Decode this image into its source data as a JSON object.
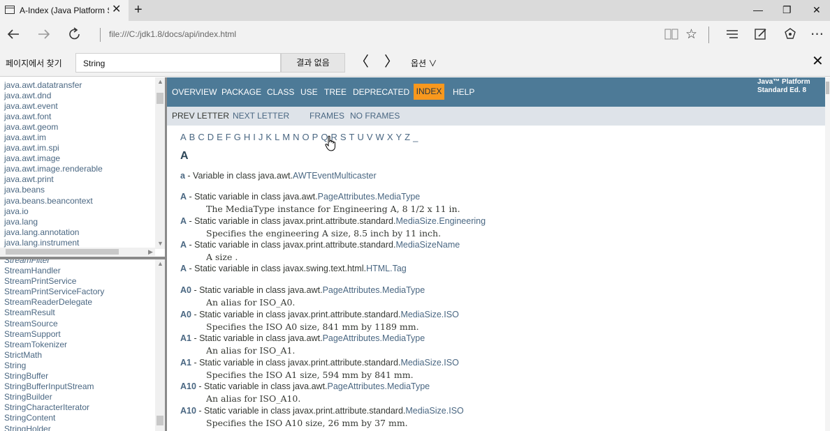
{
  "browser": {
    "tab_title": "A-Index (Java Platform S",
    "tab_close": "✕",
    "new_tab": "+",
    "window_minimize": "—",
    "window_restore": "❐",
    "window_close": "✕",
    "url": "file:///C:/jdk1.8/docs/api/index.html"
  },
  "find_bar": {
    "label": "페이지에서 찾기",
    "value": "String",
    "result": "결과 없음",
    "options": "옵션 ∨",
    "close": "✕",
    "prev": "〈",
    "next": "〉"
  },
  "packages": [
    "java.awt.datatransfer",
    "java.awt.dnd",
    "java.awt.event",
    "java.awt.font",
    "java.awt.geom",
    "java.awt.im",
    "java.awt.im.spi",
    "java.awt.image",
    "java.awt.image.renderable",
    "java.awt.print",
    "java.beans",
    "java.beans.beancontext",
    "java.io",
    "java.lang",
    "java.lang.annotation",
    "java.lang.instrument"
  ],
  "classes": [
    {
      "name": "StreamFilter",
      "italic": true
    },
    {
      "name": "StreamHandler",
      "italic": false
    },
    {
      "name": "StreamPrintService",
      "italic": false
    },
    {
      "name": "StreamPrintServiceFactory",
      "italic": false
    },
    {
      "name": "StreamReaderDelegate",
      "italic": false
    },
    {
      "name": "StreamResult",
      "italic": false
    },
    {
      "name": "StreamSource",
      "italic": false
    },
    {
      "name": "StreamSupport",
      "italic": false
    },
    {
      "name": "StreamTokenizer",
      "italic": false
    },
    {
      "name": "StrictMath",
      "italic": false
    },
    {
      "name": "String",
      "italic": false
    },
    {
      "name": "StringBuffer",
      "italic": false
    },
    {
      "name": "StringBufferInputStream",
      "italic": false
    },
    {
      "name": "StringBuilder",
      "italic": false
    },
    {
      "name": "StringCharacterIterator",
      "italic": false
    },
    {
      "name": "StringContent",
      "italic": false
    },
    {
      "name": "StringHolder",
      "italic": false
    }
  ],
  "topnav": {
    "overview": "OVERVIEW",
    "package": "PACKAGE",
    "class": "CLASS",
    "use": "USE",
    "tree": "TREE",
    "deprecated": "DEPRECATED",
    "index": "INDEX",
    "help": "HELP",
    "about_line1": "Java™ Platform",
    "about_line2": "Standard Ed. 8"
  },
  "subnav": {
    "prev_letter": "PREV LETTER",
    "next_letter": "NEXT LETTER",
    "frames": "FRAMES",
    "no_frames": "NO FRAMES"
  },
  "letters": [
    "A",
    "B",
    "C",
    "D",
    "E",
    "F",
    "G",
    "H",
    "I",
    "J",
    "K",
    "L",
    "M",
    "N",
    "O",
    "P",
    "Q",
    "R",
    "S",
    "T",
    "U",
    "V",
    "W",
    "X",
    "Y",
    "Z",
    "_"
  ],
  "letter_heading": "A",
  "entries": [
    {
      "term": "a",
      "text": " - Variable in class java.awt.",
      "link": "AWTEventMulticaster",
      "desc": ""
    },
    {
      "term": "A",
      "text": " - Static variable in class java.awt.",
      "link": "PageAttributes.MediaType",
      "desc": "The MediaType instance for Engineering A, 8 1/2 x 11 in."
    },
    {
      "term": "A",
      "text": " - Static variable in class javax.print.attribute.standard.",
      "link": "MediaSize.Engineering",
      "desc": "Specifies the engineering A size, 8.5 inch by 11 inch."
    },
    {
      "term": "A",
      "text": " - Static variable in class javax.print.attribute.standard.",
      "link": "MediaSizeName",
      "desc": "A size ."
    },
    {
      "term": "A",
      "text": " - Static variable in class javax.swing.text.html.",
      "link": "HTML.Tag",
      "desc": ""
    },
    {
      "term": "A0",
      "text": " - Static variable in class java.awt.",
      "link": "PageAttributes.MediaType",
      "desc": "An alias for ISO_A0."
    },
    {
      "term": "A0",
      "text": " - Static variable in class javax.print.attribute.standard.",
      "link": "MediaSize.ISO",
      "desc": "Specifies the ISO A0 size, 841 mm by 1189 mm."
    },
    {
      "term": "A1",
      "text": " - Static variable in class java.awt.",
      "link": "PageAttributes.MediaType",
      "desc": "An alias for ISO_A1."
    },
    {
      "term": "A1",
      "text": " - Static variable in class javax.print.attribute.standard.",
      "link": "MediaSize.ISO",
      "desc": "Specifies the ISO A1 size, 594 mm by 841 mm."
    },
    {
      "term": "A10",
      "text": " - Static variable in class java.awt.",
      "link": "PageAttributes.MediaType",
      "desc": "An alias for ISO_A10."
    },
    {
      "term": "A10",
      "text": " - Static variable in class javax.print.attribute.standard.",
      "link": "MediaSize.ISO",
      "desc": "Specifies the ISO A10 size, 26 mm by 37 mm."
    }
  ],
  "colors": {
    "topnav_bg": "#4d7a97",
    "index_highlight": "#f8981d",
    "subnav_bg": "#dee3e9",
    "link": "#4a6782"
  }
}
